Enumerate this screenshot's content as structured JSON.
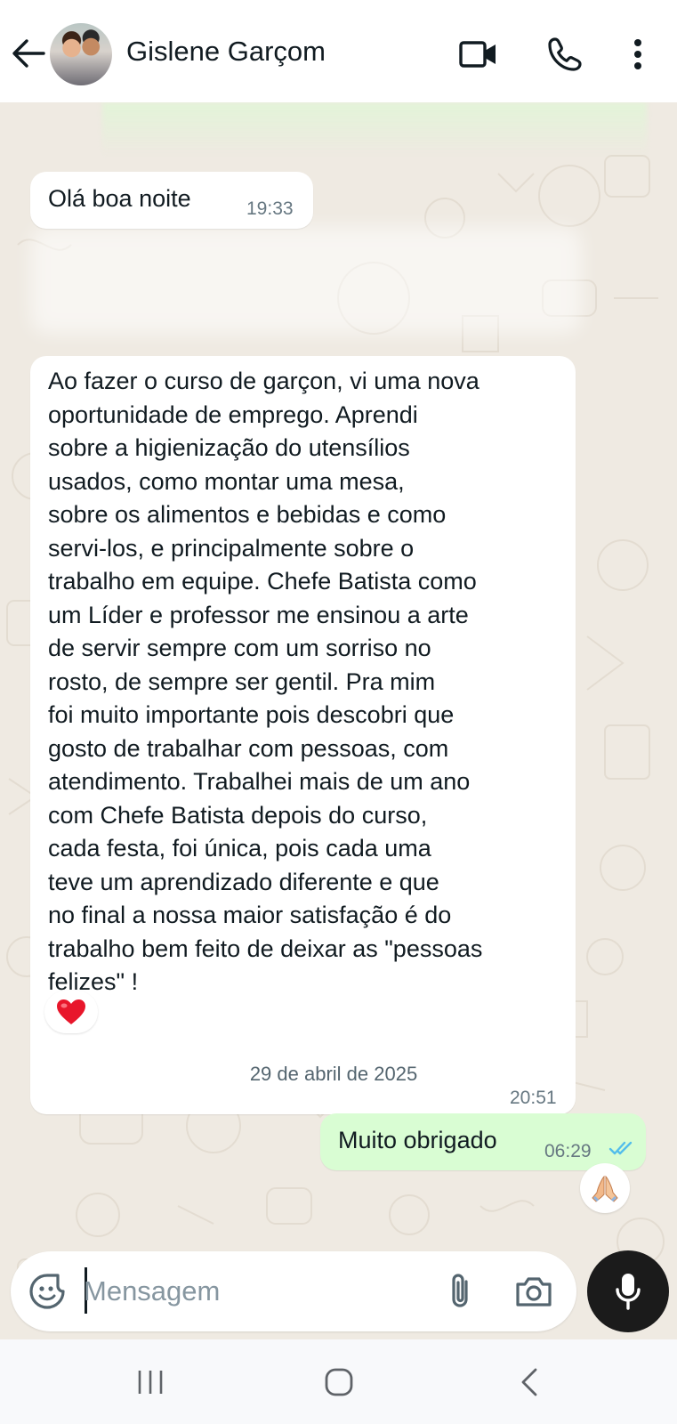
{
  "header": {
    "contact_name": "Gislene Garçom",
    "icons": [
      "arrow-left-icon",
      "video-camera-icon",
      "phone-icon",
      "more-vertical-icon"
    ]
  },
  "messages": [
    {
      "direction": "in",
      "text": "Olá  boa noite",
      "time": "19:33"
    },
    {
      "direction": "in",
      "text": "Ao fazer o curso de garçon, vi uma nova\noportunidade de emprego. Aprendi\nsobre a higienização do utensílios\nusados, como montar uma mesa,\nsobre os alimentos e bebidas e como\nservi-los, e principalmente sobre o\ntrabalho em equipe. Chefe Batista como\num Líder e professor me ensinou a arte\nde servir sempre com um sorriso no\nrosto, de sempre ser gentil. Pra mim\nfoi muito importante pois descobri que\ngosto de trabalhar com pessoas, com\natendimento. Trabalhei mais de um ano\ncom Chefe Batista depois do curso,\ncada festa, foi única,  pois cada uma\nteve um aprendizado diferente e que\nno final a nossa maior satisfação é do\ntrabalho bem feito de deixar as \"pessoas\nfelizes\" !",
      "time": "20:51",
      "reaction": "heart-emoji"
    },
    {
      "direction": "out",
      "text": "Muito obrigado",
      "time": "06:29",
      "status": "read",
      "reaction": "folded-hands-emoji"
    }
  ],
  "date_separator": "29 de abril de 2025",
  "composer": {
    "placeholder": "Mensagem",
    "icons": [
      "sticker-icon",
      "paperclip-icon",
      "camera-icon",
      "microphone-icon"
    ]
  },
  "colors": {
    "chat_background": "#efeae2",
    "incoming_bubble": "#ffffff",
    "outgoing_bubble": "#d9fdd3",
    "read_ticks": "#53bdeb",
    "mic_button": "#1b1b1b"
  },
  "navbar": {
    "icons": [
      "recents-icon",
      "home-icon",
      "back-icon"
    ]
  }
}
